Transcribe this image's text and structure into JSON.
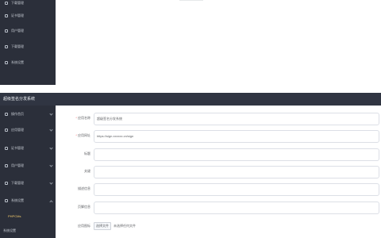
{
  "app": {
    "title": "超级签名分发系统"
  },
  "top_fragment": {
    "sidebar_items": [
      {
        "label": "下载管理"
      },
      {
        "label": "证书管理"
      },
      {
        "label": "用户管理"
      },
      {
        "label": "下载管理"
      },
      {
        "label": "系统设置"
      }
    ]
  },
  "sidebar": {
    "items": [
      {
        "label": "操作首页"
      },
      {
        "label": "应用管理"
      },
      {
        "label": "证书管理"
      },
      {
        "label": "用户管理"
      },
      {
        "label": "下载管理"
      },
      {
        "label": "系统设置"
      }
    ],
    "sub_items": [
      {
        "label": "PHPCMs"
      },
      {
        "label": "系统设置"
      }
    ]
  },
  "form": {
    "fields": [
      {
        "label": "应用名称",
        "required": true,
        "value": "超级签名分发系统"
      },
      {
        "label": "应用网址",
        "required": true,
        "value": "https://sign.xxxxxx.cn/sign"
      },
      {
        "label": "标题",
        "required": false,
        "value": ""
      },
      {
        "label": "关键",
        "required": false,
        "value": ""
      },
      {
        "label": "描述信息",
        "required": false,
        "value": ""
      },
      {
        "label": "页脚信息",
        "required": false,
        "value": ""
      }
    ],
    "upload": {
      "label": "应用图标",
      "button": "选择文件",
      "hint": "未选择任何文件"
    }
  },
  "colors": {
    "sidebar_bg": "#2b2f3a",
    "titlebar_bg": "#303542",
    "active_submenu": "#f2c96b",
    "required": "#f56c6c"
  }
}
